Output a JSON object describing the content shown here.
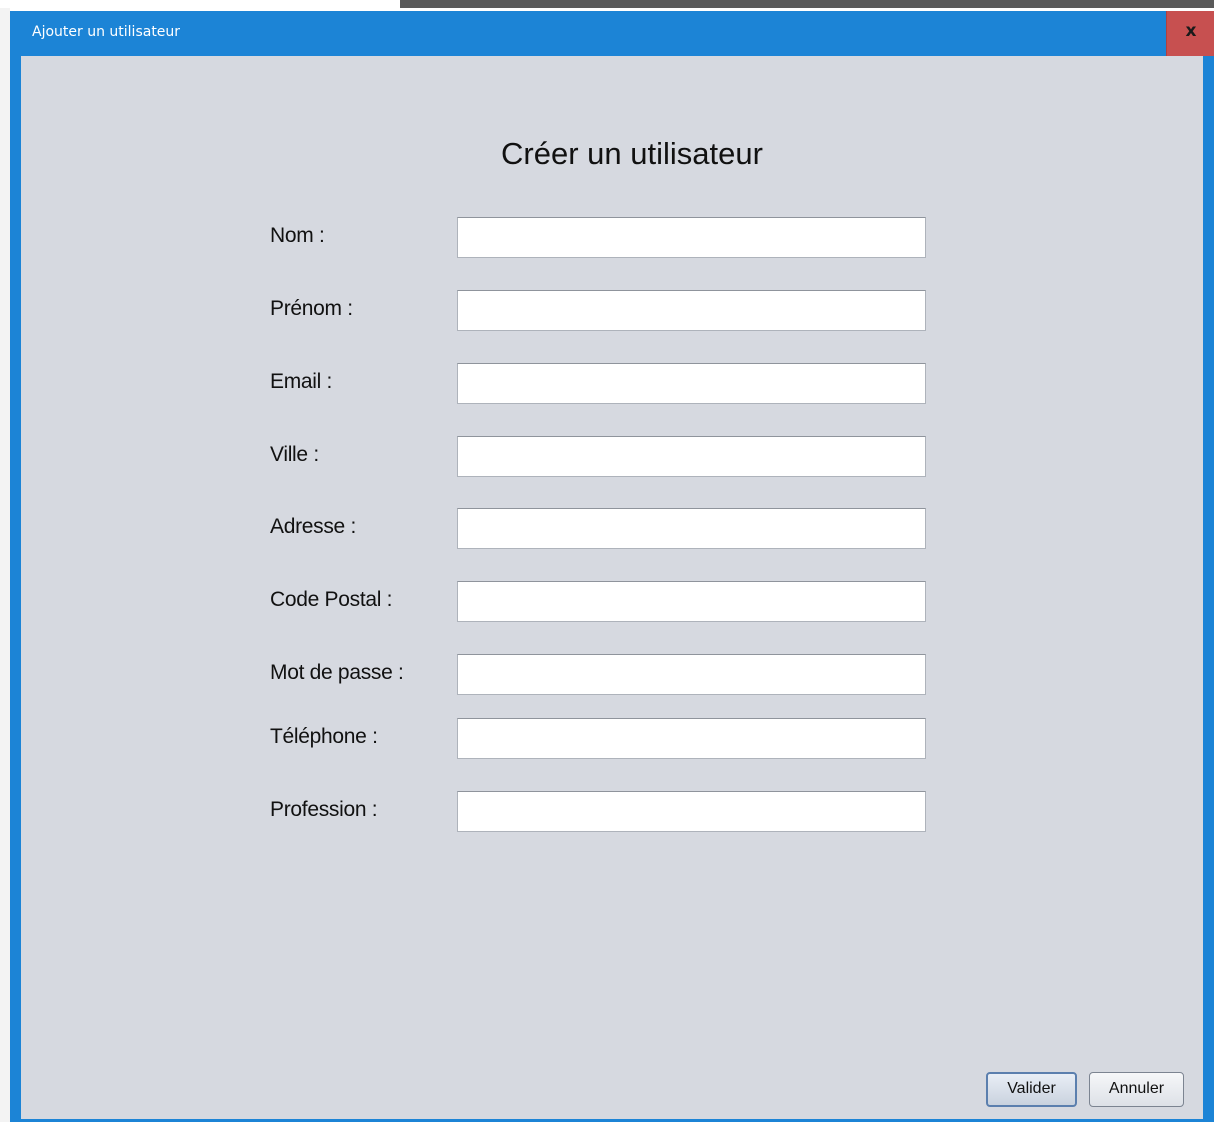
{
  "window": {
    "title": "Ajouter un utilisateur",
    "close_glyph": "x"
  },
  "form": {
    "title": "Créer un utilisateur",
    "fields": [
      {
        "label": "Nom :",
        "value": ""
      },
      {
        "label": "Prénom :",
        "value": ""
      },
      {
        "label": "Email :",
        "value": ""
      },
      {
        "label": "Ville :",
        "value": ""
      },
      {
        "label": "Adresse :",
        "value": ""
      },
      {
        "label": "Code Postal :",
        "value": ""
      },
      {
        "label": "Mot de passe :",
        "value": ""
      },
      {
        "label": "Téléphone :",
        "value": ""
      },
      {
        "label": "Profession :",
        "value": ""
      }
    ]
  },
  "actions": {
    "submit_label": "Valider",
    "cancel_label": "Annuler"
  },
  "colors": {
    "titlebar": "#1c84d6",
    "close_button": "#c75050",
    "content_background": "#d6d9e0"
  },
  "icons": {
    "close": "close-icon"
  }
}
